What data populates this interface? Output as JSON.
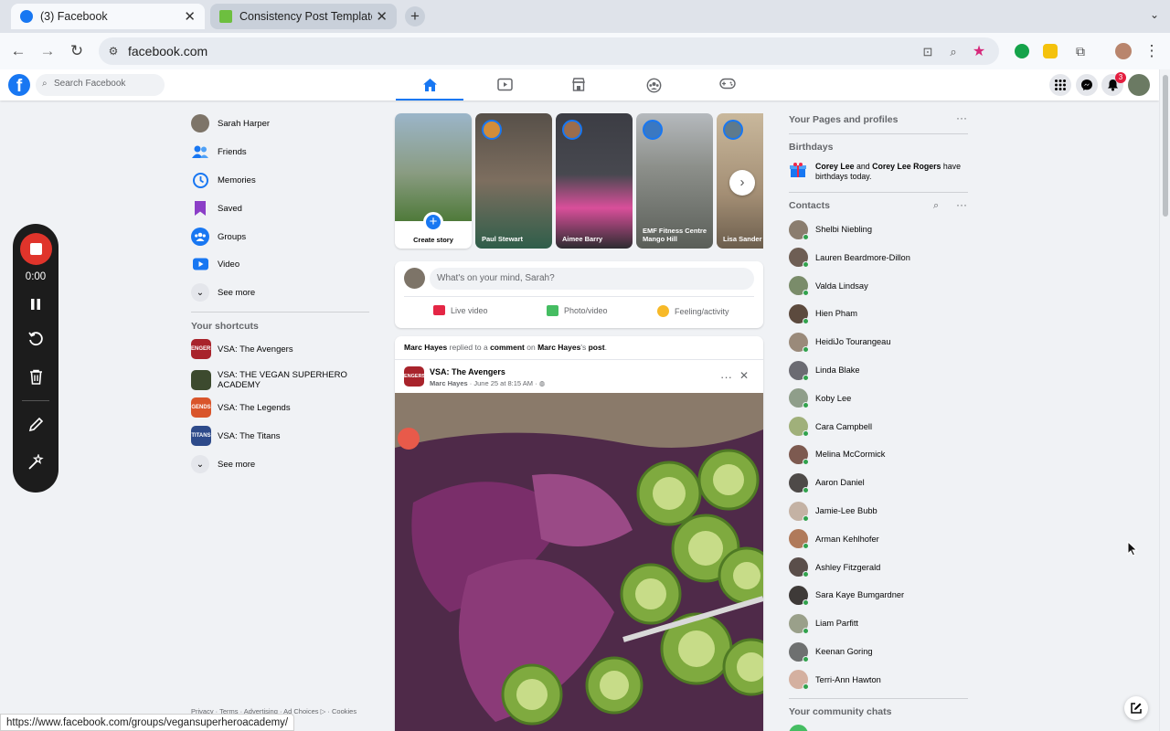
{
  "browser": {
    "tabs": [
      {
        "title": "(3) Facebook",
        "active": true
      },
      {
        "title": "Consistency Post Templates",
        "active": false
      }
    ],
    "new_tab": "+",
    "url": "facebook.com",
    "status_url": "https://www.facebook.com/groups/vegansuperheroacademy/"
  },
  "header": {
    "logo": "f",
    "search_placeholder": "Search Facebook",
    "notification_count": "3",
    "nav_tabs": [
      "home-icon",
      "video-icon",
      "marketplace-icon",
      "groups-icon",
      "gaming-icon"
    ]
  },
  "left_nav": {
    "items": [
      {
        "label": "Sarah Harper",
        "icon": "profile-avatar"
      },
      {
        "label": "Friends",
        "icon": "friends-icon"
      },
      {
        "label": "Memories",
        "icon": "memories-icon"
      },
      {
        "label": "Saved",
        "icon": "saved-icon"
      },
      {
        "label": "Groups",
        "icon": "groups-icon"
      },
      {
        "label": "Video",
        "icon": "video-icon"
      },
      {
        "label": "See more",
        "icon": "chevron-down-icon"
      }
    ],
    "shortcuts_title": "Your shortcuts",
    "shortcuts": [
      {
        "label": "VSA: The Avengers",
        "icon_text": "ENGERS"
      },
      {
        "label": "VSA: THE VEGAN SUPERHERO ACADEMY",
        "icon_text": ""
      },
      {
        "label": "VSA: The Legends",
        "icon_text": "GENDS"
      },
      {
        "label": "VSA: The Titans",
        "icon_text": "TITANS"
      }
    ],
    "shortcuts_see_more": "See more",
    "footer": "Privacy · Terms · Advertising · Ad Choices ▷ · Cookies"
  },
  "stories": {
    "create_label": "Create story",
    "items": [
      {
        "name": "Paul Stewart"
      },
      {
        "name": "Aimee Barry"
      },
      {
        "name": "EMF Fitness Centre Mango Hill"
      },
      {
        "name": "Lisa Sander"
      }
    ]
  },
  "composer": {
    "placeholder": "What's on your mind, Sarah?",
    "actions": [
      "Live video",
      "Photo/video",
      "Feeling/activity"
    ]
  },
  "post": {
    "activity": {
      "actor": "Marc Hayes",
      "verb1": "replied to a",
      "obj1": "comment",
      "on": "on",
      "owner": "Marc Hayes",
      "suffix": "'s",
      "obj2": "post",
      "end": "."
    },
    "group": "VSA: The Avengers",
    "author": "Marc Hayes",
    "date": "June 25 at 8:15 AM",
    "group_icon_text": "ENGERS"
  },
  "right": {
    "pages_title": "Your Pages and profiles",
    "birthdays_title": "Birthdays",
    "birthday": {
      "name1": "Corey Lee",
      "and": "and",
      "name2": "Corey Lee Rogers",
      "text": "have birthdays today."
    },
    "contacts_title": "Contacts",
    "contacts": [
      "Shelbi Niebling",
      "Lauren Beardmore-Dillon",
      "Valda Lindsay",
      "Hien Pham",
      "HeidiJo Tourangeau",
      "Linda Blake",
      "Koby Lee",
      "Cara Campbell",
      "Melina McCormick",
      "Aaron Daniel",
      "Jamie-Lee Bubb",
      "Arman Kehlhofer",
      "Ashley Fitzgerald",
      "Sara Kaye Bumgardner",
      "Liam Parfitt",
      "Keenan Goring",
      "Terri-Ann Hawton"
    ],
    "community_title": "Your community chats"
  },
  "recorder": {
    "time": "0:00"
  },
  "colors": {
    "fb_blue": "#1877f2",
    "online_green": "#31a24c",
    "record_red": "#e0342b"
  }
}
